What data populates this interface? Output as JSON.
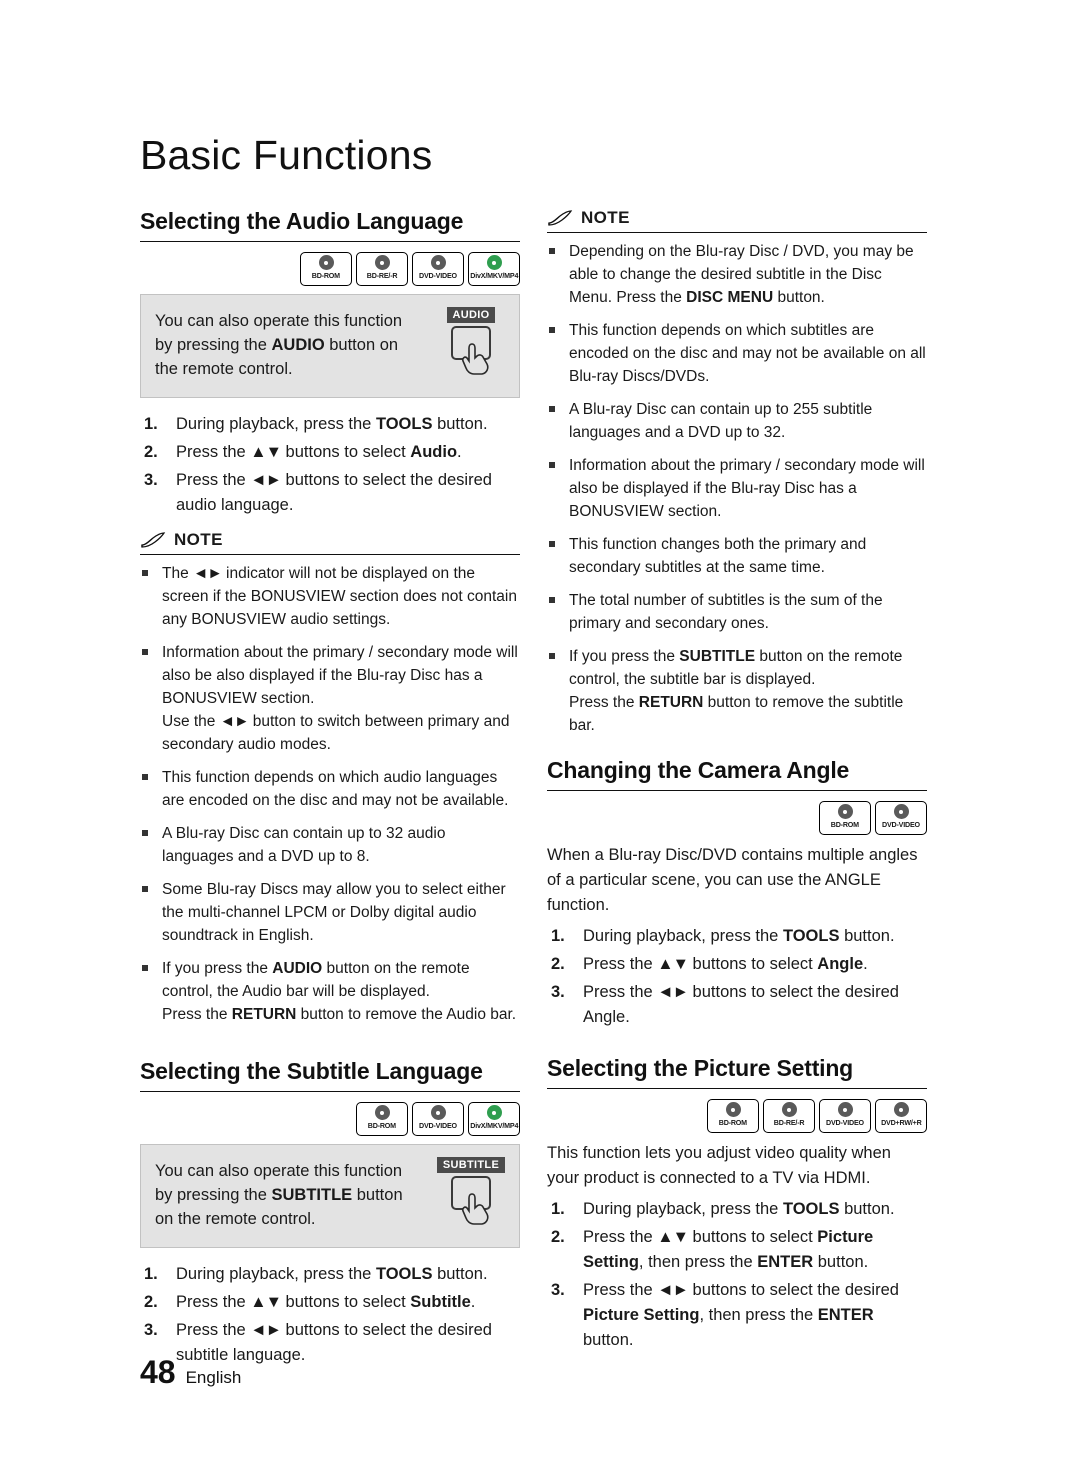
{
  "chapter": {
    "title": "Basic Functions"
  },
  "footer": {
    "page_number": "48",
    "language": "English"
  },
  "note_label": "NOTE",
  "sections": {
    "audio_language": {
      "title": "Selecting the Audio Language",
      "badges": [
        {
          "label": "BD-ROM",
          "color": "grey"
        },
        {
          "label": "BD-RE/-R",
          "color": "grey"
        },
        {
          "label": "DVD-VIDEO",
          "color": "grey"
        },
        {
          "label": "DivX/MKV/MP4",
          "color": "green"
        }
      ],
      "tip_text": "You can also operate this function by pressing the AUDIO button on the remote control.",
      "tip_key": "AUDIO",
      "steps": [
        "During playback, press the TOOLS button.",
        "Press the ▲▼ buttons to select Audio.",
        "Press the ◄► buttons to select the desired audio language."
      ],
      "notes": [
        "The ◄► indicator will not be displayed on the screen if the BONUSVIEW section does not contain any BONUSVIEW audio settings.",
        "Information about the primary / secondary mode will also be also displayed if the Blu-ray Disc has a BONUSVIEW section. Use the ◄► button to switch between primary and secondary audio modes.",
        "This function depends on which audio languages are encoded on the disc and may not be available.",
        "A Blu-ray Disc can contain up to 32 audio languages and a DVD up to 8.",
        "Some Blu-ray Discs may allow you to select either the multi-channel LPCM or Dolby digital audio soundtrack in English.",
        "If you press the AUDIO button on the remote control, the Audio bar will be displayed. Press the RETURN button to remove the Audio bar."
      ]
    },
    "subtitle_language": {
      "title": "Selecting the Subtitle Language",
      "badges": [
        {
          "label": "BD-ROM",
          "color": "grey"
        },
        {
          "label": "DVD-VIDEO",
          "color": "grey"
        },
        {
          "label": "DivX/MKV/MP4",
          "color": "green"
        }
      ],
      "tip_text": "You can also operate this function by pressing the SUBTITLE button on the remote control.",
      "tip_key": "SUBTITLE",
      "steps": [
        "During playback, press the TOOLS button.",
        "Press the ▲▼ buttons to select Subtitle.",
        "Press the ◄► buttons to select the desired subtitle language."
      ],
      "notes": [
        "Depending on the Blu-ray Disc / DVD, you may be able to change the desired subtitle in the Disc Menu. Press the DISC MENU button.",
        "This function depends on which subtitles are encoded on the disc and may not be available on all Blu-ray Discs/DVDs.",
        "A Blu-ray Disc can contain up to 255 subtitle languages and a DVD up to 32.",
        "Information about the primary / secondary mode will also be displayed if the Blu-ray Disc has a BONUSVIEW section.",
        "This function changes both the primary and secondary subtitles at the same time.",
        "The total number of subtitles is the sum of the primary and secondary ones.",
        "If you press the SUBTITLE button on the remote control, the subtitle bar is displayed. Press the RETURN button to remove the subtitle bar."
      ]
    },
    "camera_angle": {
      "title": "Changing the Camera Angle",
      "badges": [
        {
          "label": "BD-ROM",
          "color": "grey"
        },
        {
          "label": "DVD-VIDEO",
          "color": "grey"
        }
      ],
      "intro": "When a Blu-ray Disc/DVD contains multiple angles of a particular scene, you can use the ANGLE function.",
      "steps": [
        "During playback, press the TOOLS button.",
        "Press the ▲▼ buttons to select Angle.",
        "Press the ◄► buttons to select the desired Angle."
      ]
    },
    "picture_setting": {
      "title": "Selecting the Picture Setting",
      "badges": [
        {
          "label": "BD-ROM",
          "color": "grey"
        },
        {
          "label": "BD-RE/-R",
          "color": "grey"
        },
        {
          "label": "DVD-VIDEO",
          "color": "grey"
        },
        {
          "label": "DVD+RW/+R",
          "color": "grey"
        }
      ],
      "intro": "This function lets you adjust video quality when your product is connected to a TV via HDMI.",
      "steps": [
        "During playback, press the TOOLS button.",
        "Press the ▲▼ buttons to select Picture Setting, then press the ENTER button.",
        "Press the ◄► buttons to select the desired Picture Setting, then press the ENTER button."
      ]
    }
  }
}
